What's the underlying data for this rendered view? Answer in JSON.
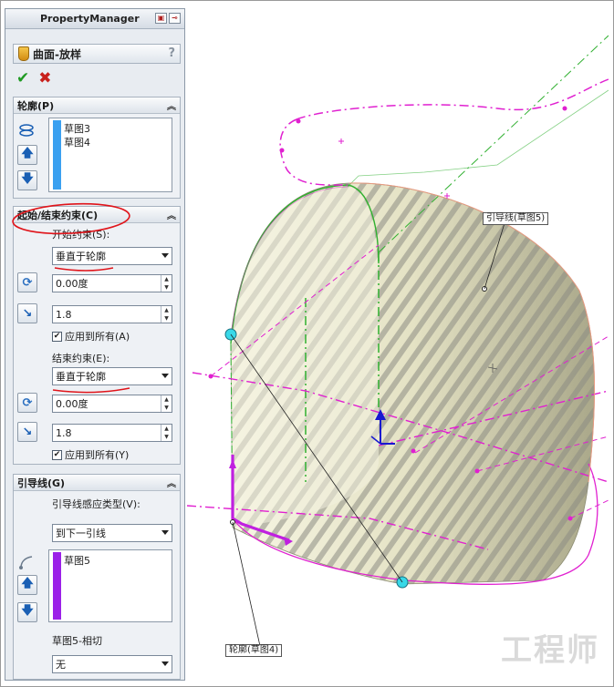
{
  "property_manager": {
    "title": "PropertyManager",
    "feature_title": "曲面-放样",
    "help_label": "?",
    "ok_symbol": "✔",
    "cancel_symbol": "✖"
  },
  "profiles_section": {
    "title": "轮廓(P)",
    "items": [
      "草图3",
      "草图4"
    ]
  },
  "constraints_section": {
    "title": "起始/结束约束(C)",
    "start_label": "开始约束(S):",
    "start_value": "垂直于轮廓",
    "start_angle": "0.00度",
    "start_length": "1.8",
    "start_apply_all": "应用到所有(A)",
    "end_label": "结束约束(E):",
    "end_value": "垂直于轮廓",
    "end_angle": "0.00度",
    "end_length": "1.8",
    "end_apply_all": "应用到所有(Y)"
  },
  "guides_section": {
    "title": "引导线(G)",
    "influence_label": "引导线感应类型(V):",
    "influence_value": "到下一引线",
    "items": [
      "草图5"
    ],
    "tangency_label": "草图5-相切",
    "tangency_value": "无"
  },
  "viewport": {
    "callout_guide": "引导线(草图5)",
    "callout_profile": "轮廓(草图4)",
    "watermark": "工程师"
  },
  "colors": {
    "profile_bar": "#3aa0f0",
    "guide_bar": "#9b20e8",
    "sketch_magenta": "#e020d0",
    "sketch_green": "#30b030",
    "annotation_red": "#e0141a"
  }
}
